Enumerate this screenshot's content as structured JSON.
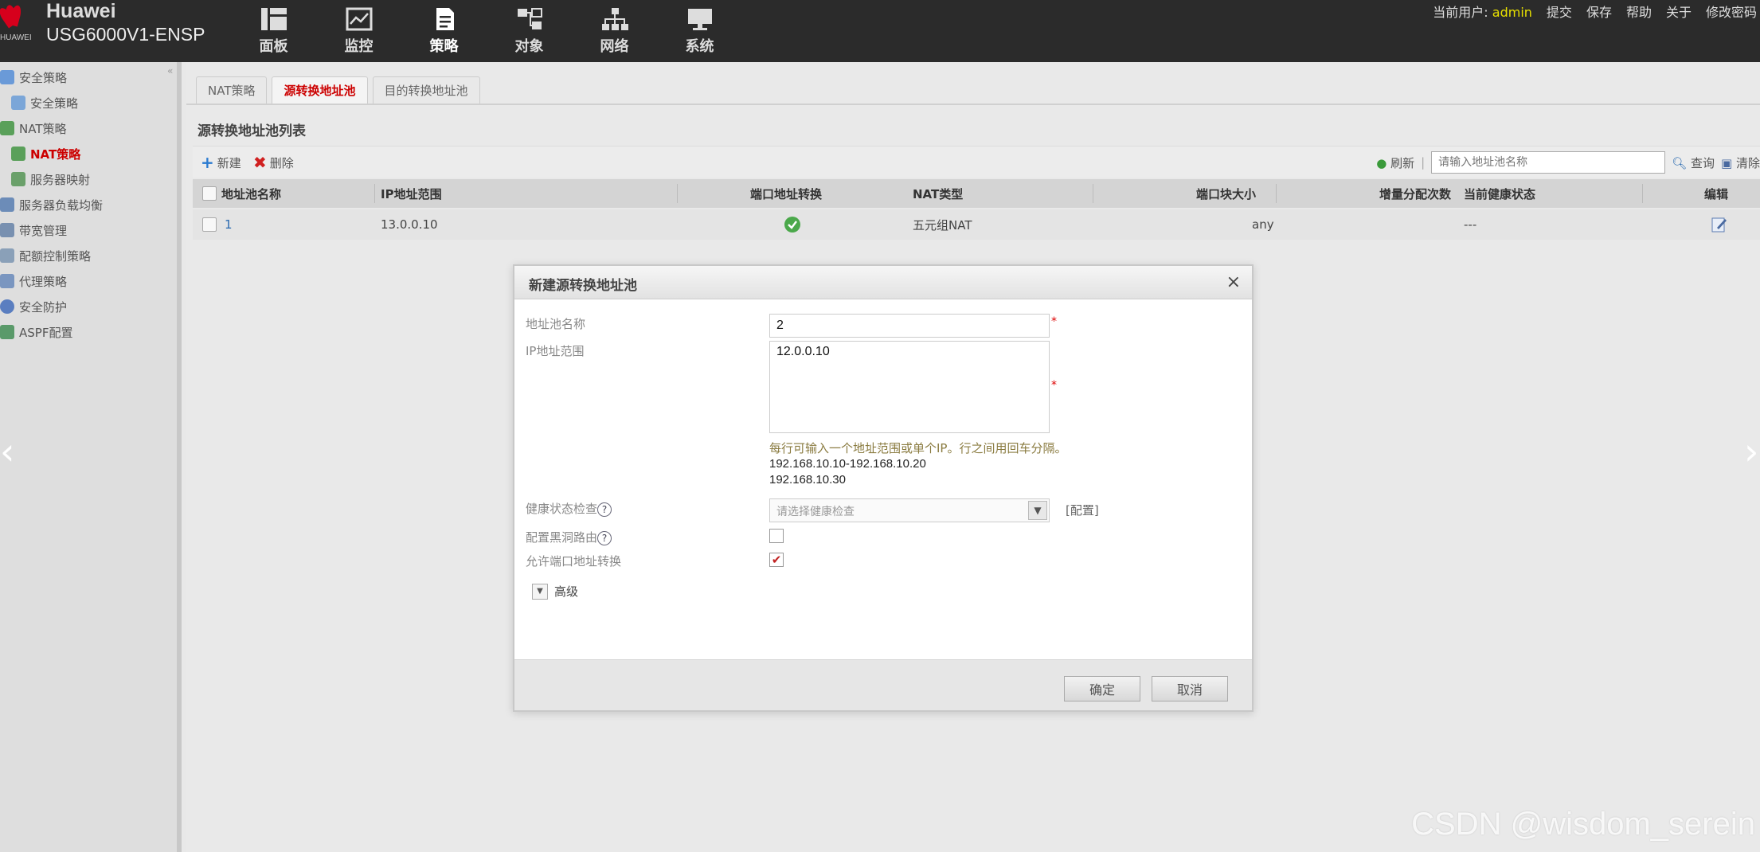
{
  "header": {
    "brand": "Huawei",
    "brand_wordmark": "HUAWEI",
    "model": "USG6000V1-ENSP",
    "nav": [
      {
        "label": "面板",
        "icon": "dashboard-icon"
      },
      {
        "label": "监控",
        "icon": "monitor-icon"
      },
      {
        "label": "策略",
        "icon": "policy-icon"
      },
      {
        "label": "对象",
        "icon": "object-icon"
      },
      {
        "label": "网络",
        "icon": "network-icon"
      },
      {
        "label": "系统",
        "icon": "system-icon"
      }
    ],
    "user_label": "当前用户:",
    "user_name": "admin",
    "links": [
      "提交",
      "保存",
      "帮助",
      "关于",
      "修改密码"
    ]
  },
  "sidebar": {
    "items": [
      {
        "label": "安全策略"
      },
      {
        "label": "安全策略"
      },
      {
        "label": "NAT策略"
      },
      {
        "label": "NAT策略"
      },
      {
        "label": "服务器映射"
      },
      {
        "label": "服务器负载均衡"
      },
      {
        "label": "带宽管理"
      },
      {
        "label": "配额控制策略"
      },
      {
        "label": "代理策略"
      },
      {
        "label": "安全防护"
      },
      {
        "label": "ASPF配置"
      }
    ]
  },
  "main": {
    "tabs": [
      "NAT策略",
      "源转换地址池",
      "目的转换地址池"
    ],
    "section_title": "源转换地址池列表",
    "toolbar": {
      "new_label": "新建",
      "delete_label": "删除",
      "refresh_label": "刷新",
      "search_placeholder": "请输入地址池名称",
      "query_label": "查询",
      "clear_label": "清除"
    },
    "table": {
      "columns": [
        "地址池名称",
        "IP地址范围",
        "端口地址转换",
        "NAT类型",
        "端口块大小",
        "增量分配次数",
        "当前健康状态",
        "编辑"
      ],
      "rows": [
        {
          "name": "1",
          "ip_range": "13.0.0.10",
          "port_translation": "enabled",
          "nat_type": "五元组NAT",
          "block_size": "any",
          "increment": "",
          "health": "---"
        }
      ]
    }
  },
  "dialog": {
    "title": "新建源转换地址池",
    "close": "×",
    "name_label": "地址池名称",
    "name_value": "2",
    "ip_label": "IP地址范围",
    "ip_value": "12.0.0.10",
    "hint_line1": "每行可输入一个地址范围或单个IP。行之间用回车分隔。",
    "hint_line2": "192.168.10.10-192.168.10.20",
    "hint_line3": "192.168.10.30",
    "health_label": "健康状态检查",
    "health_placeholder": "请选择健康检查",
    "config_link": "[配置]",
    "blackhole_label": "配置黑洞路由",
    "allow_pat_label": "允许端口地址转换",
    "allow_pat_checked": true,
    "advanced_label": "高级",
    "ok_label": "确定",
    "cancel_label": "取消",
    "required_mark": "*",
    "help_mark": "?"
  },
  "watermark": "CSDN @wisdom_serein",
  "colors": {
    "accent": "#cc0000",
    "header_bg": "#2b2b2b",
    "user": "#e8e000"
  }
}
